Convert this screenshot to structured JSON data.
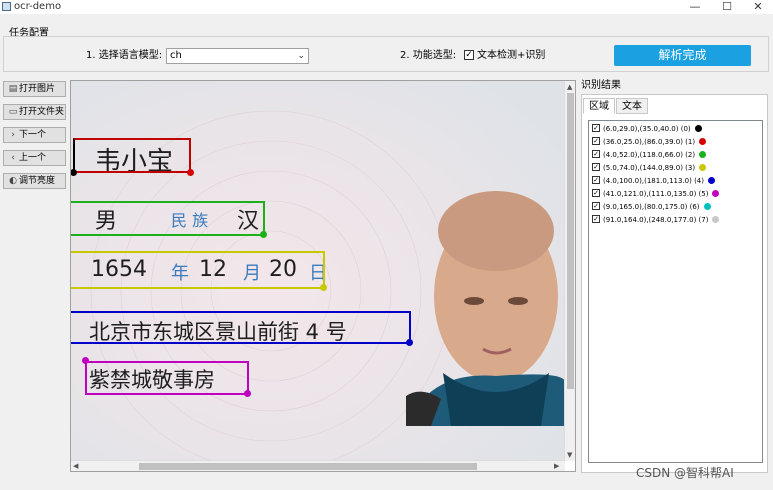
{
  "window": {
    "title": "ocr-demo",
    "minimize": "—",
    "maximize": "☐",
    "close": "✕"
  },
  "config": {
    "group_title": "任务配置",
    "lang_label": "1. 选择语言模型:",
    "lang_value": "ch",
    "func_label": "2. 功能选型:",
    "func_check_label": "文本检测+识别",
    "func_checked": true,
    "parse_button": "解析完成"
  },
  "sidebar": [
    {
      "name": "open-image-button",
      "icon": "image-icon",
      "glyph": "▤",
      "label": "打开图片"
    },
    {
      "name": "open-folder-button",
      "icon": "folder-icon",
      "glyph": "▭",
      "label": "打开文件夹"
    },
    {
      "name": "next-button",
      "icon": "chevron-right-icon",
      "glyph": "›",
      "label": "下一个"
    },
    {
      "name": "prev-button",
      "icon": "chevron-left-icon",
      "glyph": "‹",
      "label": "上一个"
    },
    {
      "name": "brightness-button",
      "icon": "brightness-icon",
      "glyph": "◐",
      "label": "调节亮度"
    }
  ],
  "image_text": {
    "name": "韦小宝",
    "gender": "男",
    "ethnicity_label": "民 族",
    "ethnicity": "汉",
    "year": "1654",
    "year_label": "年",
    "month": "12",
    "month_label": "月",
    "day": "20",
    "day_label": "日",
    "address": "北京市东城区景山前街 4 号",
    "address2": "紫禁城敬事房"
  },
  "results": {
    "title": "识别结果",
    "tabs": [
      "区域",
      "文本"
    ],
    "active_tab": 0,
    "items": [
      {
        "text": "(6.0,29.0),(35.0,40.0) (0)",
        "color": "#000000"
      },
      {
        "text": "(36.0,25.0),(86.0,39.0) (1)",
        "color": "#d40000"
      },
      {
        "text": "(4.0,52.0),(118.0,66.0) (2)",
        "color": "#1cb01c"
      },
      {
        "text": "(5.0,74.0),(144.0,89.0) (3)",
        "color": "#c8c800"
      },
      {
        "text": "(4.0,100.0),(181.0,113.0) (4)",
        "color": "#0000c8"
      },
      {
        "text": "(41.0,121.0),(111.0,135.0) (5)",
        "color": "#c000c0"
      },
      {
        "text": "(9.0,165.0),(80.0,175.0) (6)",
        "color": "#00c0c0"
      },
      {
        "text": "(91.0,164.0),(248.0,177.0) (7)",
        "color": "#c8c8c8"
      }
    ]
  },
  "watermark": "CSDN @智科帮AI"
}
